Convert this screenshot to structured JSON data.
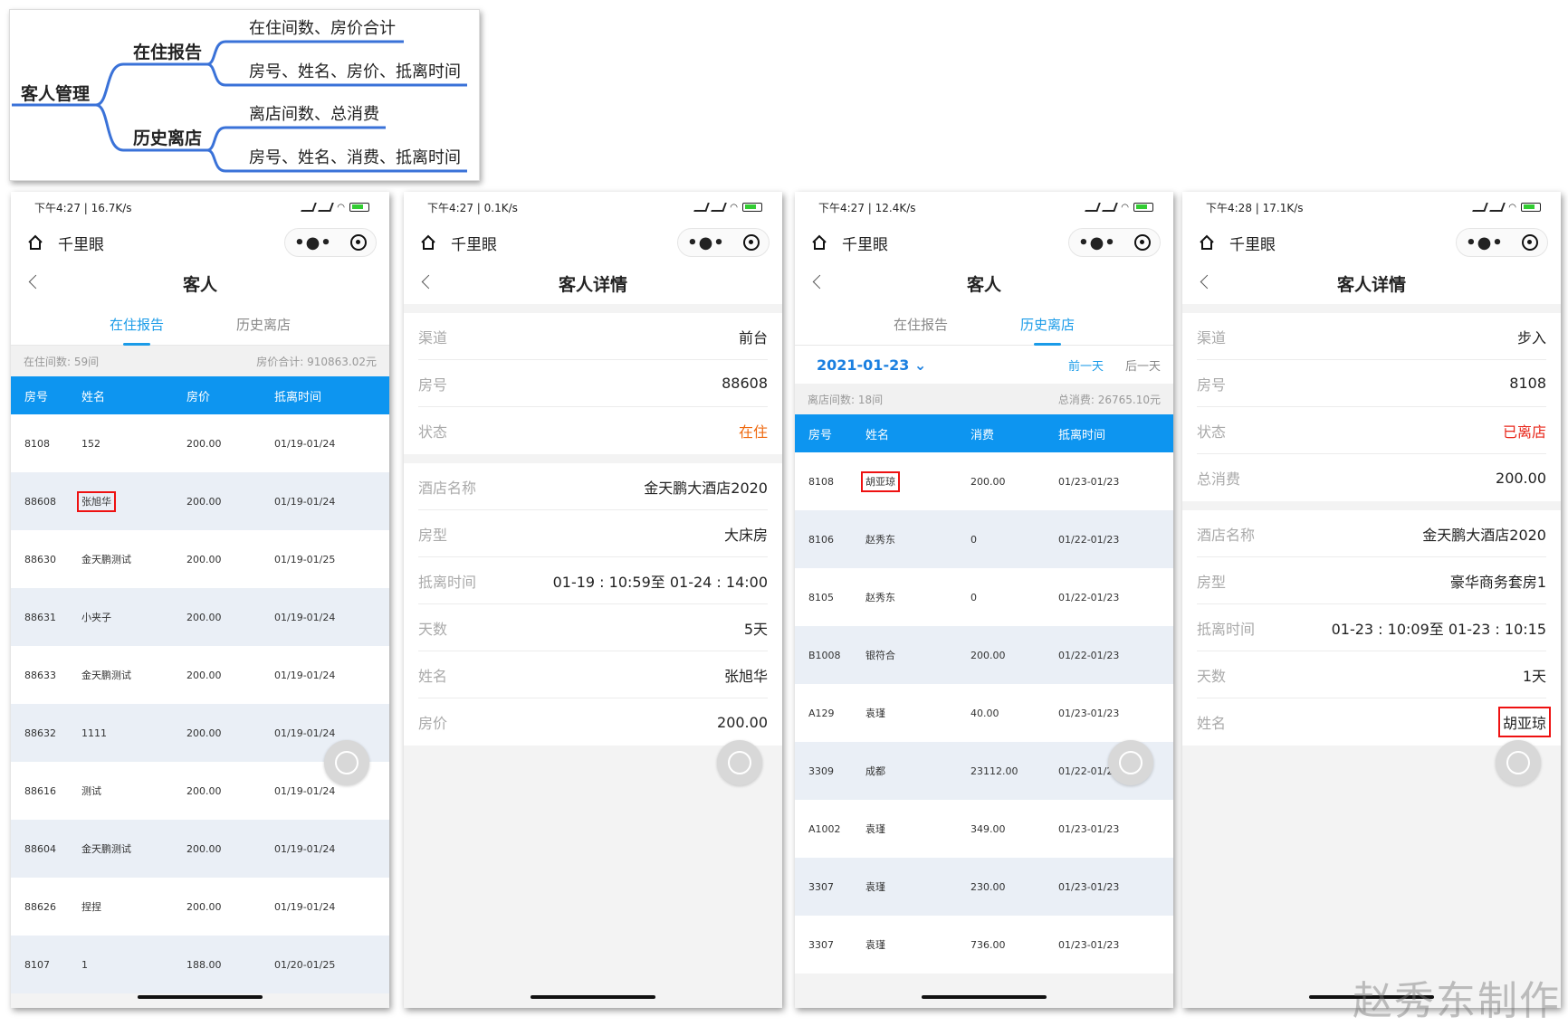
{
  "mindmap": {
    "root": "客人管理",
    "branch1": "在住报告",
    "branch1_leaf1": "在住间数、房价合计",
    "branch1_leaf2": "房号、姓名、房价、抵离时间",
    "branch2": "历史离店",
    "branch2_leaf1": "离店间数、总消费",
    "branch2_leaf2": "房号、姓名、消费、抵离时间"
  },
  "common": {
    "app_name": "千里眼",
    "more": "•●•"
  },
  "phone1": {
    "status_time": "下午4:27 | 16.7K/s",
    "title": "客人",
    "tab_active": "在住报告",
    "tab_other": "历史离店",
    "summary_left": "在住间数: 59间",
    "summary_right": "房价合计: 910863.02元",
    "headers": [
      "房号",
      "姓名",
      "房价",
      "抵离时间"
    ],
    "rows": [
      [
        "8108",
        "152",
        "200.00",
        "01/19-01/24"
      ],
      [
        "88608",
        "张旭华",
        "200.00",
        "01/19-01/24"
      ],
      [
        "88630",
        "金天鹏测试",
        "200.00",
        "01/19-01/25"
      ],
      [
        "88631",
        "小夹子",
        "200.00",
        "01/19-01/24"
      ],
      [
        "88633",
        "金天鹏测试",
        "200.00",
        "01/19-01/24"
      ],
      [
        "88632",
        "1111",
        "200.00",
        "01/19-01/24"
      ],
      [
        "88616",
        "测试",
        "200.00",
        "01/19-01/24"
      ],
      [
        "88604",
        "金天鹏测试",
        "200.00",
        "01/19-01/24"
      ],
      [
        "88626",
        "捏捏",
        "200.00",
        "01/19-01/24"
      ],
      [
        "8107",
        "1",
        "188.00",
        "01/20-01/25"
      ]
    ]
  },
  "phone2": {
    "status_time": "下午4:27 | 0.1K/s",
    "title": "客人详情",
    "group1": [
      {
        "label": "渠道",
        "value": "前台"
      },
      {
        "label": "房号",
        "value": "88608"
      },
      {
        "label": "状态",
        "value": "在住"
      }
    ],
    "group2": [
      {
        "label": "酒店名称",
        "value": "金天鹏大酒店2020"
      },
      {
        "label": "房型",
        "value": "大床房"
      },
      {
        "label": "抵离时间",
        "value": "01-19 : 10:59至 01-24 : 14:00"
      },
      {
        "label": "天数",
        "value": "5天"
      },
      {
        "label": "姓名",
        "value": "张旭华"
      },
      {
        "label": "房价",
        "value": "200.00"
      }
    ]
  },
  "phone3": {
    "status_time": "下午4:27 | 12.4K/s",
    "title": "客人",
    "tab_other": "在住报告",
    "tab_active": "历史离店",
    "date": "2021-01-23",
    "prev_day": "前一天",
    "next_day": "后一天",
    "summary_left": "离店间数: 18间",
    "summary_right": "总消费: 26765.10元",
    "headers": [
      "房号",
      "姓名",
      "消费",
      "抵离时间"
    ],
    "rows": [
      [
        "8108",
        "胡亚琼",
        "200.00",
        "01/23-01/23"
      ],
      [
        "8106",
        "赵秀东",
        "0",
        "01/22-01/23"
      ],
      [
        "8105",
        "赵秀东",
        "0",
        "01/22-01/23"
      ],
      [
        "B1008",
        "银符合",
        "200.00",
        "01/22-01/23"
      ],
      [
        "A129",
        "袁瑾",
        "40.00",
        "01/23-01/23"
      ],
      [
        "3309",
        "成都",
        "23112.00",
        "01/22-01/23"
      ],
      [
        "A1002",
        "袁瑾",
        "349.00",
        "01/23-01/23"
      ],
      [
        "3307",
        "袁瑾",
        "230.00",
        "01/23-01/23"
      ],
      [
        "3307",
        "袁瑾",
        "736.00",
        "01/23-01/23"
      ]
    ]
  },
  "phone4": {
    "status_time": "下午4:28 | 17.1K/s",
    "title": "客人详情",
    "group1": [
      {
        "label": "渠道",
        "value": "步入"
      },
      {
        "label": "房号",
        "value": "8108"
      },
      {
        "label": "状态",
        "value": "已离店"
      },
      {
        "label": "总消费",
        "value": "200.00"
      }
    ],
    "group2": [
      {
        "label": "酒店名称",
        "value": "金天鹏大酒店2020"
      },
      {
        "label": "房型",
        "value": "豪华商务套房1"
      },
      {
        "label": "抵离时间",
        "value": "01-23 : 10:09至 01-23 : 10:15"
      },
      {
        "label": "天数",
        "value": "1天"
      },
      {
        "label": "姓名",
        "value": "胡亚琼"
      }
    ]
  },
  "watermark": "赵秀东制作",
  "colors": {
    "accent": "#1a9be8",
    "header": "#0d95f0",
    "status_live": "#ef6a10",
    "status_left": "#e8261a"
  }
}
